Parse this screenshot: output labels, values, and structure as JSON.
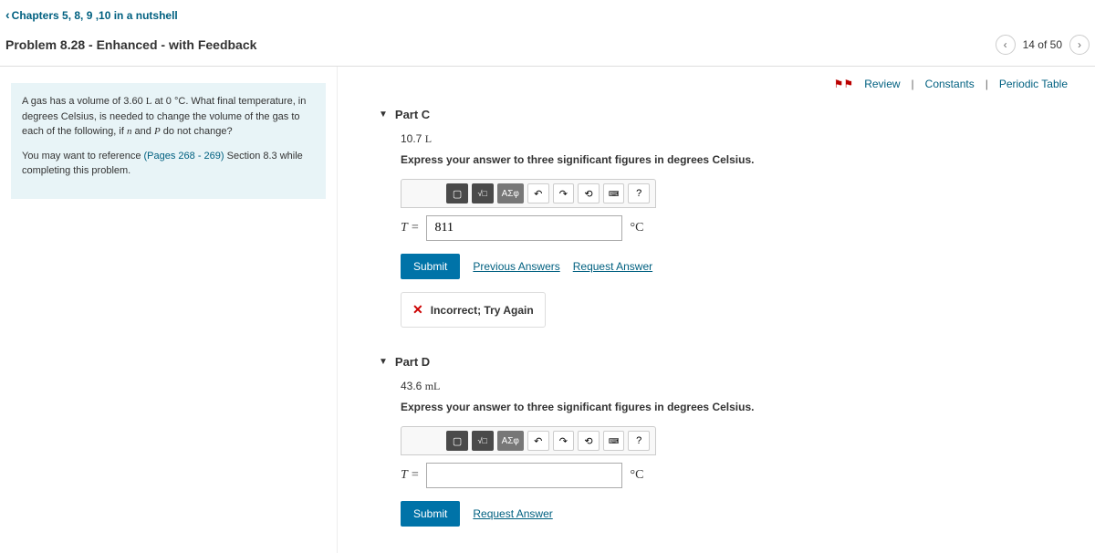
{
  "breadcrumb": "Chapters 5, 8, 9 ,10 in a nutshell",
  "problemTitle": "Problem 8.28 - Enhanced - with Feedback",
  "pageInfo": "14 of 50",
  "topLinks": {
    "review": "Review",
    "constants": "Constants",
    "periodic": "Periodic Table"
  },
  "question": {
    "para1_pre": "A gas has a volume of 3.60 ",
    "para1_L": "L",
    "para1_mid": " at 0 ",
    "para1_deg": "°C",
    "para1_post": ". What final temperature, in degrees Celsius, is needed to change the volume of the gas to each of the following, if ",
    "para1_n": "n",
    "para1_and": " and ",
    "para1_P": "P",
    "para1_end": " do not change?",
    "para2_pre": "You may want to reference ",
    "para2_ref": "(Pages 268 - 269)",
    "para2_post": " Section 8.3 while completing this problem."
  },
  "partC": {
    "title": "Part C",
    "value": "10.7",
    "valueUnit": "L",
    "instruction": "Express your answer to three significant figures in degrees Celsius.",
    "varLabel": "T =",
    "inputValue": "811",
    "unit": "°C",
    "submit": "Submit",
    "prevAnswers": "Previous Answers",
    "requestAnswer": "Request Answer",
    "feedback": "Incorrect; Try Again"
  },
  "partD": {
    "title": "Part D",
    "value": "43.6",
    "valueUnit": "mL",
    "instruction": "Express your answer to three significant figures in degrees Celsius.",
    "varLabel": "T =",
    "inputValue": "",
    "unit": "°C",
    "submit": "Submit",
    "requestAnswer": "Request Answer"
  },
  "toolbar": {
    "greek": "ΑΣφ",
    "help": "?"
  }
}
